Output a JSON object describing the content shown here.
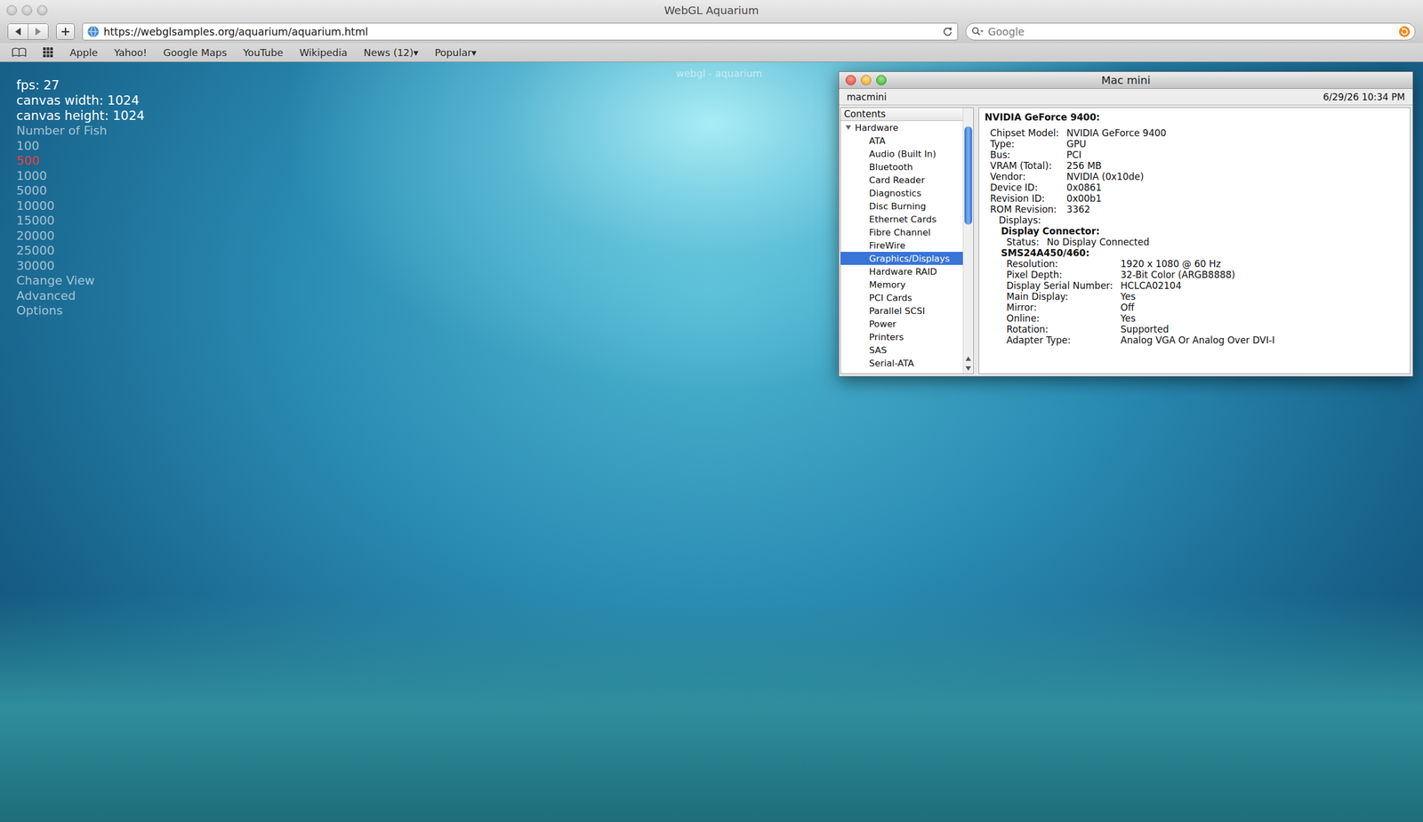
{
  "browser": {
    "title": "WebGL Aquarium",
    "url": "https://webglsamples.org/aquarium/aquarium.html",
    "search_placeholder": "Google",
    "bookmarks": [
      "Apple",
      "Yahoo!",
      "Google Maps",
      "YouTube",
      "Wikipedia",
      "News (12)▾",
      "Popular▾"
    ]
  },
  "scene": {
    "title": "webgl - aquarium",
    "stats": [
      "fps: 27",
      "canvas width: 1024",
      "canvas height: 1024"
    ],
    "fish_label": "Number of Fish",
    "fish_counts": [
      {
        "label": "100",
        "selected": false
      },
      {
        "label": "500",
        "selected": true
      },
      {
        "label": "1000",
        "selected": false
      },
      {
        "label": "5000",
        "selected": false
      },
      {
        "label": "10000",
        "selected": false
      },
      {
        "label": "15000",
        "selected": false
      },
      {
        "label": "20000",
        "selected": false
      },
      {
        "label": "25000",
        "selected": false
      },
      {
        "label": "30000",
        "selected": false
      }
    ],
    "links": [
      "Change View",
      "Advanced",
      "Options"
    ]
  },
  "profiler": {
    "title": "Mac mini",
    "computer": "macmini",
    "date": "6/29/26 10:34 PM",
    "contents_label": "Contents",
    "tree": {
      "label": "Hardware",
      "expanded": true,
      "items": [
        {
          "label": "ATA",
          "selected": false
        },
        {
          "label": "Audio (Built In)",
          "selected": false
        },
        {
          "label": "Bluetooth",
          "selected": false
        },
        {
          "label": "Card Reader",
          "selected": false
        },
        {
          "label": "Diagnostics",
          "selected": false
        },
        {
          "label": "Disc Burning",
          "selected": false
        },
        {
          "label": "Ethernet Cards",
          "selected": false
        },
        {
          "label": "Fibre Channel",
          "selected": false
        },
        {
          "label": "FireWire",
          "selected": false
        },
        {
          "label": "Graphics/Displays",
          "selected": true
        },
        {
          "label": "Hardware RAID",
          "selected": false
        },
        {
          "label": "Memory",
          "selected": false
        },
        {
          "label": "PCI Cards",
          "selected": false
        },
        {
          "label": "Parallel SCSI",
          "selected": false
        },
        {
          "label": "Power",
          "selected": false
        },
        {
          "label": "Printers",
          "selected": false
        },
        {
          "label": "SAS",
          "selected": false
        },
        {
          "label": "Serial-ATA",
          "selected": false
        }
      ]
    },
    "details": {
      "heading": "NVIDIA GeForce 9400:",
      "fields": [
        {
          "key": "Chipset Model:",
          "value": "NVIDIA GeForce 9400"
        },
        {
          "key": "Type:",
          "value": "GPU"
        },
        {
          "key": "Bus:",
          "value": "PCI"
        },
        {
          "key": "VRAM (Total):",
          "value": "256 MB"
        },
        {
          "key": "Vendor:",
          "value": "NVIDIA (0x10de)"
        },
        {
          "key": "Device ID:",
          "value": "0x0861"
        },
        {
          "key": "Revision ID:",
          "value": "0x00b1"
        },
        {
          "key": "ROM Revision:",
          "value": "3362"
        }
      ],
      "displays_label": "Displays:",
      "displays": [
        {
          "name": "Display Connector:",
          "fields": [
            {
              "key": "Status:",
              "value": "No Display Connected"
            }
          ]
        },
        {
          "name": "SMS24A450/460:",
          "fields": [
            {
              "key": "Resolution:",
              "value": "1920 x 1080 @ 60 Hz"
            },
            {
              "key": "Pixel Depth:",
              "value": "32-Bit Color (ARGB8888)"
            },
            {
              "key": "Display Serial Number:",
              "value": "HCLCA02104"
            },
            {
              "key": "Main Display:",
              "value": "Yes"
            },
            {
              "key": "Mirror:",
              "value": "Off"
            },
            {
              "key": "Online:",
              "value": "Yes"
            },
            {
              "key": "Rotation:",
              "value": "Supported"
            },
            {
              "key": "Adapter Type:",
              "value": "Analog VGA Or Analog Over DVI-I"
            }
          ]
        }
      ]
    }
  }
}
